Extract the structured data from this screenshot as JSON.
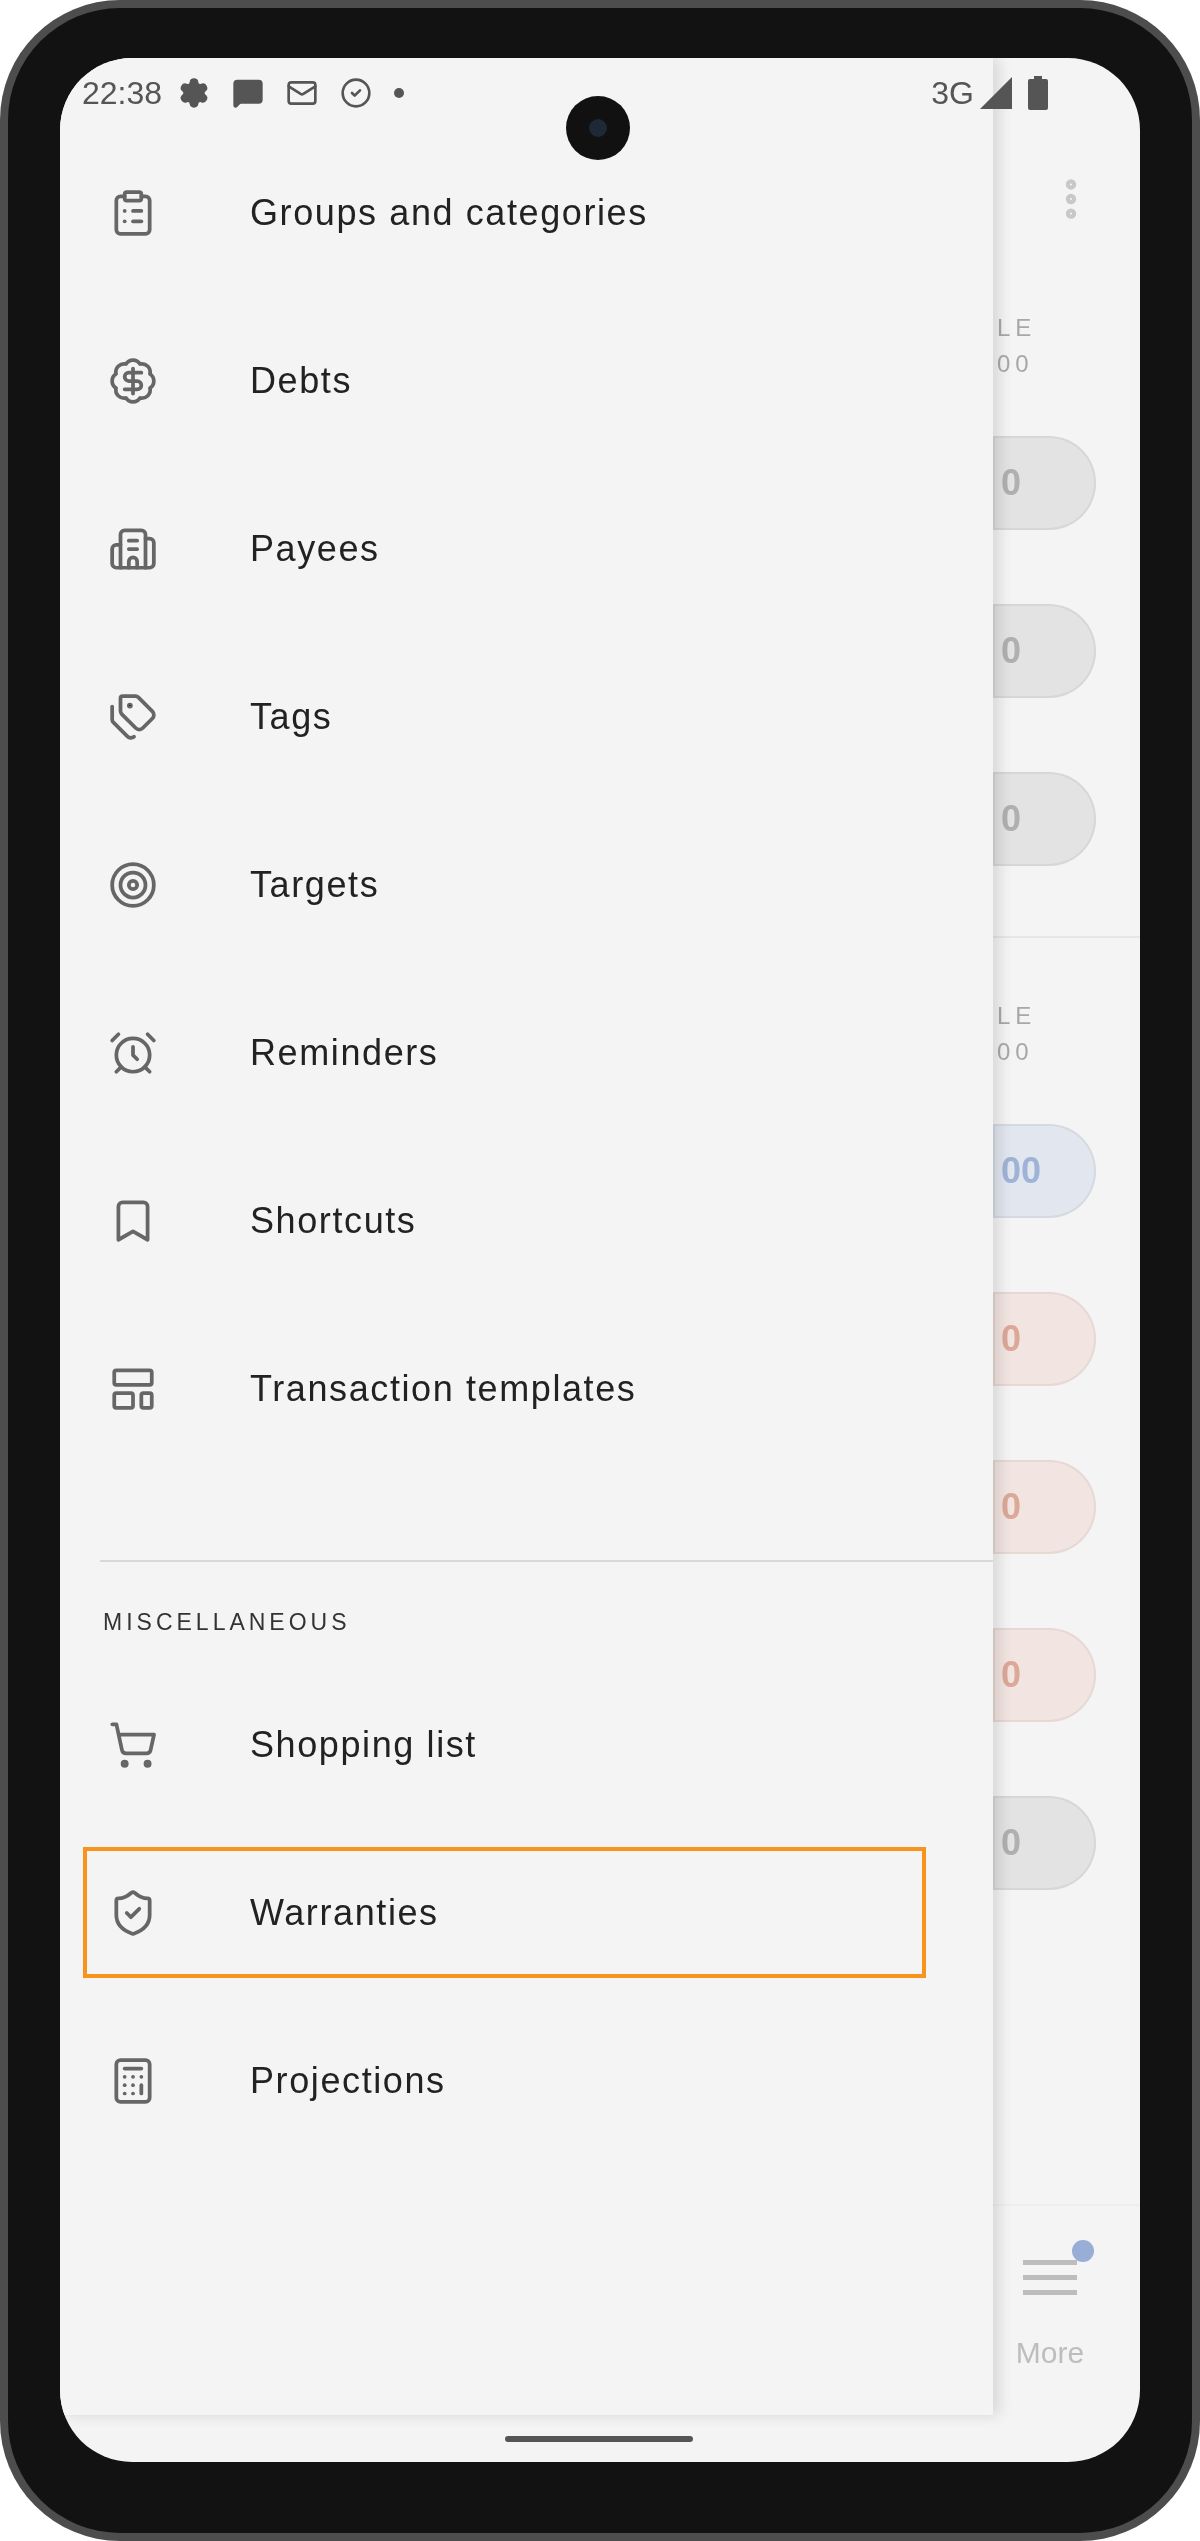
{
  "status_bar": {
    "time": "22:38",
    "network": "3G"
  },
  "drawer": {
    "items": [
      {
        "label": "Groups and categories",
        "highlighted": false
      },
      {
        "label": "Debts",
        "highlighted": false
      },
      {
        "label": "Payees",
        "highlighted": false
      },
      {
        "label": "Tags",
        "highlighted": false
      },
      {
        "label": "Targets",
        "highlighted": false
      },
      {
        "label": "Reminders",
        "highlighted": false
      },
      {
        "label": "Shortcuts",
        "highlighted": false
      },
      {
        "label": "Transaction templates",
        "highlighted": false
      }
    ],
    "section": {
      "title": "MISCELLANEOUS",
      "items": [
        {
          "label": "Shopping list",
          "highlighted": false
        },
        {
          "label": "Warranties",
          "highlighted": true
        },
        {
          "label": "Projections",
          "highlighted": false
        }
      ]
    }
  },
  "background_screen": {
    "sections": [
      {
        "header_lines": [
          "LE",
          "00"
        ],
        "pills": [
          {
            "text": "0",
            "color": "#e3e3e3"
          },
          {
            "text": "0",
            "color": "#e3e3e3"
          },
          {
            "text": "0",
            "color": "#e3e3e3"
          }
        ]
      },
      {
        "header_lines": [
          "LE",
          "00"
        ],
        "pills": [
          {
            "text": "00",
            "color": "#e1e6ef"
          },
          {
            "text": "0",
            "color": "#f2e4e1"
          },
          {
            "text": "0",
            "color": "#f2e4e1"
          },
          {
            "text": "0",
            "color": "#f2e4e1"
          },
          {
            "text": "0",
            "color": "#e3e3e3"
          }
        ]
      }
    ],
    "nav_item": {
      "label": "More",
      "badge": true
    }
  }
}
